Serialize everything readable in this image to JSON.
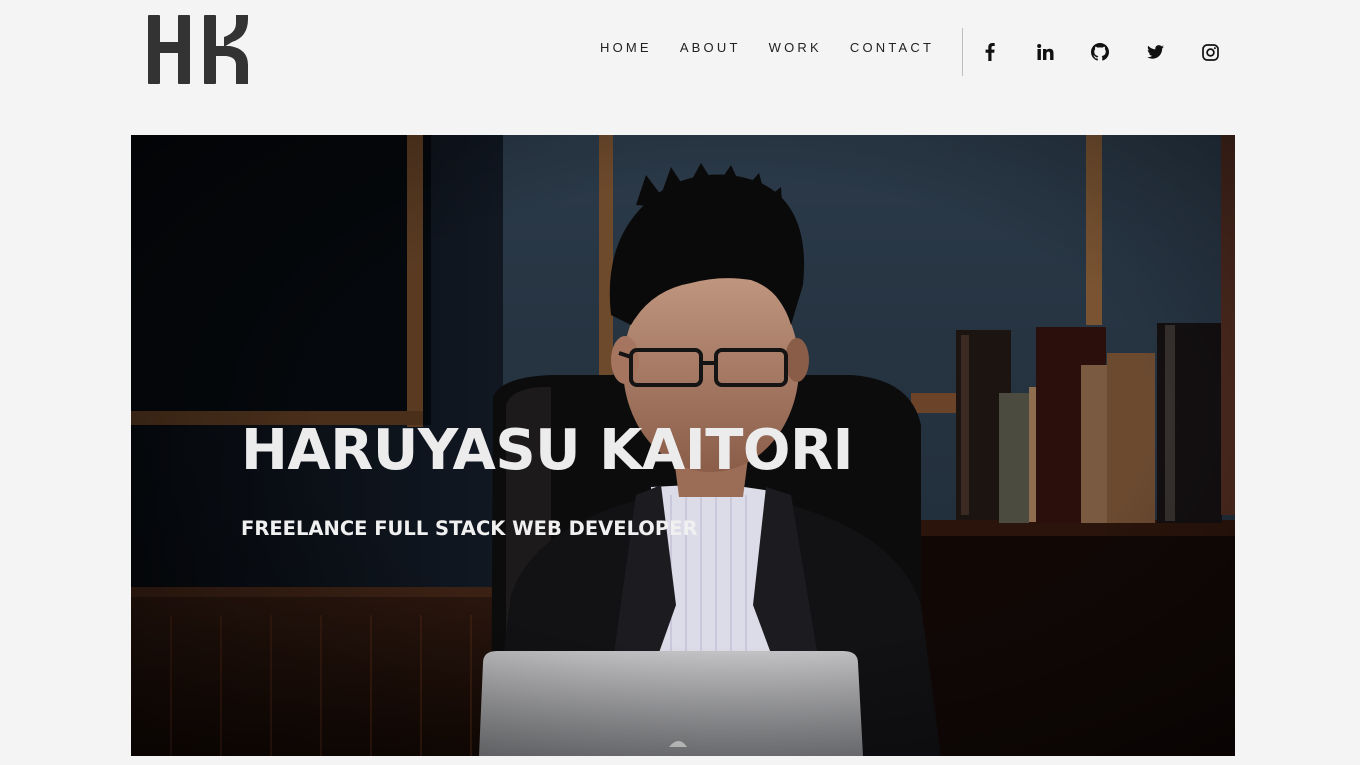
{
  "brand": {
    "logo_text": "HK",
    "logo_color": "#333333"
  },
  "nav": {
    "items": [
      {
        "label": "HOME"
      },
      {
        "label": "ABOUT"
      },
      {
        "label": "WORK"
      },
      {
        "label": "CONTACT"
      }
    ]
  },
  "social": [
    {
      "icon": "facebook-icon"
    },
    {
      "icon": "linkedin-icon"
    },
    {
      "icon": "github-icon"
    },
    {
      "icon": "twitter-icon"
    },
    {
      "icon": "instagram-icon"
    }
  ],
  "hero": {
    "title": "HARUYASU KAITORI",
    "subtitle": "FREELANCE FULL STACK WEB DEVELOPER",
    "image_subject": "portrait of developer in dark suit at laptop in front of bookshelf"
  },
  "colors": {
    "page_background": "#f4f4f4",
    "text": "#222222",
    "hero_text": "#ececec",
    "hero_background": "#1b2230"
  }
}
